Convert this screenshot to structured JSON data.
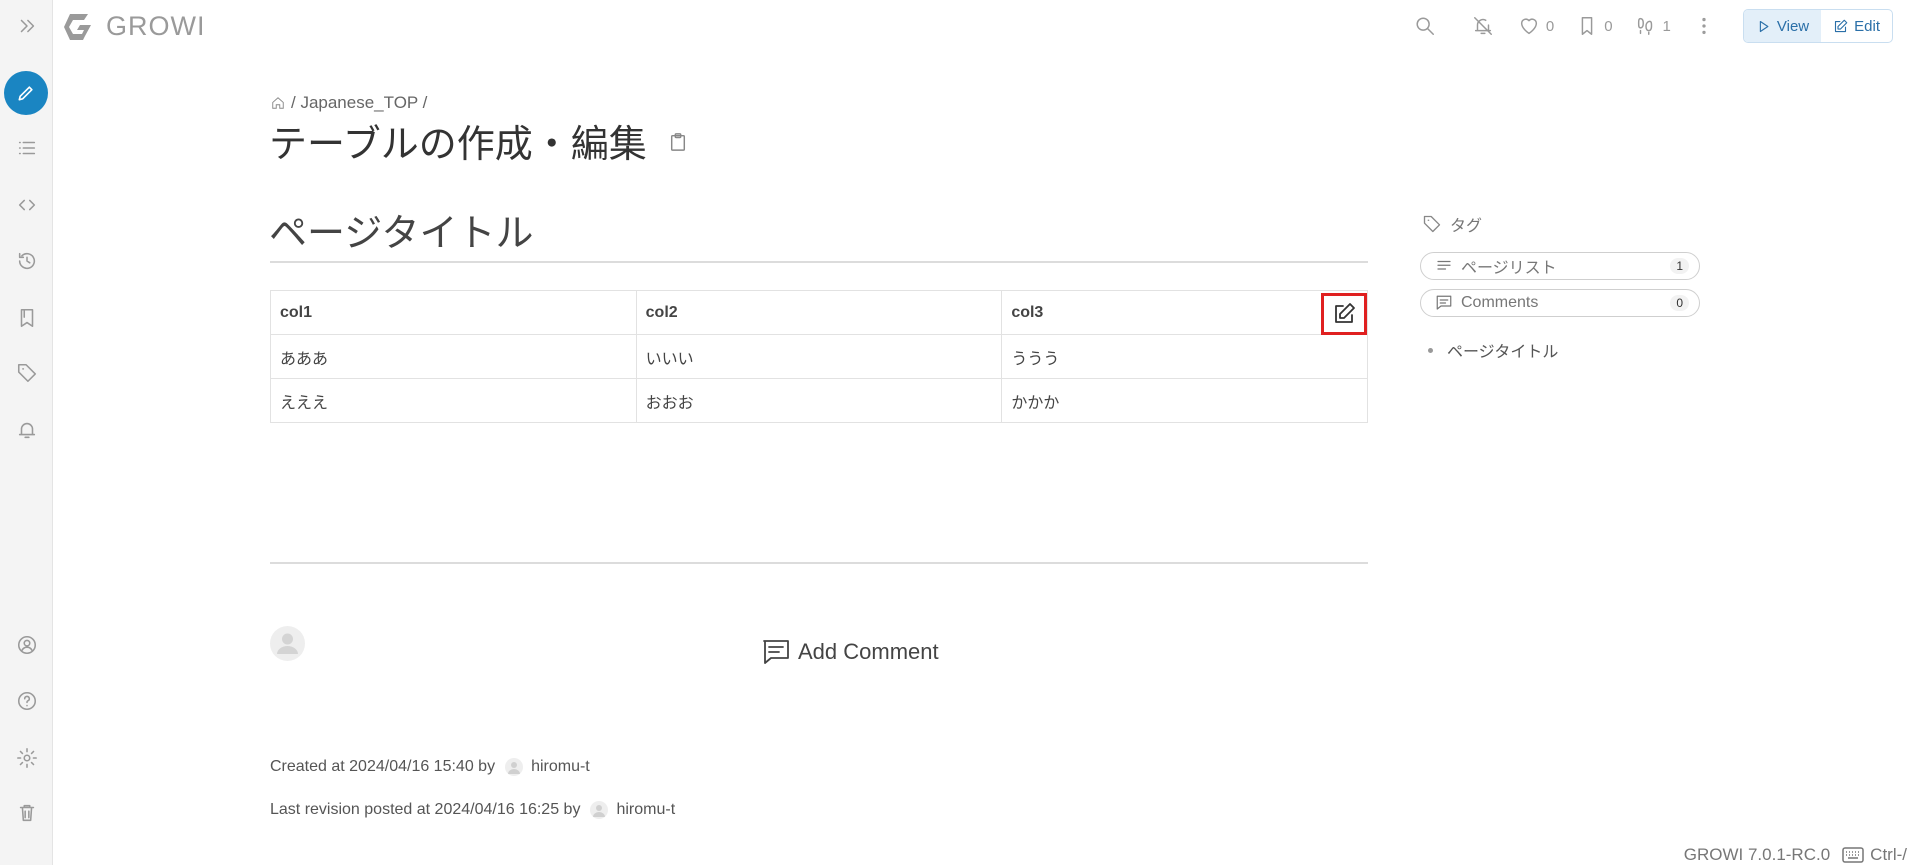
{
  "app": {
    "name": "GROWI",
    "version": "GROWI 7.0.1-RC.0",
    "shortcut": "Ctrl-/"
  },
  "navbar": {
    "like_count": "0",
    "bookmark_count": "0",
    "seen_count": "1",
    "view_label": "View",
    "edit_label": "Edit"
  },
  "breadcrumb": {
    "path": "/ Japanese_TOP /"
  },
  "page": {
    "title": "テーブルの作成・編集"
  },
  "content": {
    "heading": "ページタイトル",
    "table": {
      "headers": [
        "col1",
        "col2",
        "col3"
      ],
      "rows": [
        [
          "あああ",
          "いいい",
          "ううう"
        ],
        [
          "えええ",
          "おおお",
          "かかか"
        ]
      ]
    }
  },
  "comment": {
    "add_label": "Add Comment"
  },
  "meta": {
    "created_prefix": "Created at 2024/04/16 15:40 by",
    "created_user": "hiromu-t",
    "revision_prefix": "Last revision posted at 2024/04/16 16:25 by",
    "revision_user": "hiromu-t"
  },
  "right_sidebar": {
    "tags_label": "タグ",
    "page_list_label": "ページリスト",
    "page_list_count": "1",
    "comments_label": "Comments",
    "comments_count": "0",
    "toc_items": [
      "ページタイトル"
    ]
  },
  "colors": {
    "accent": "#1a85c2",
    "highlight_border": "#e02020"
  }
}
